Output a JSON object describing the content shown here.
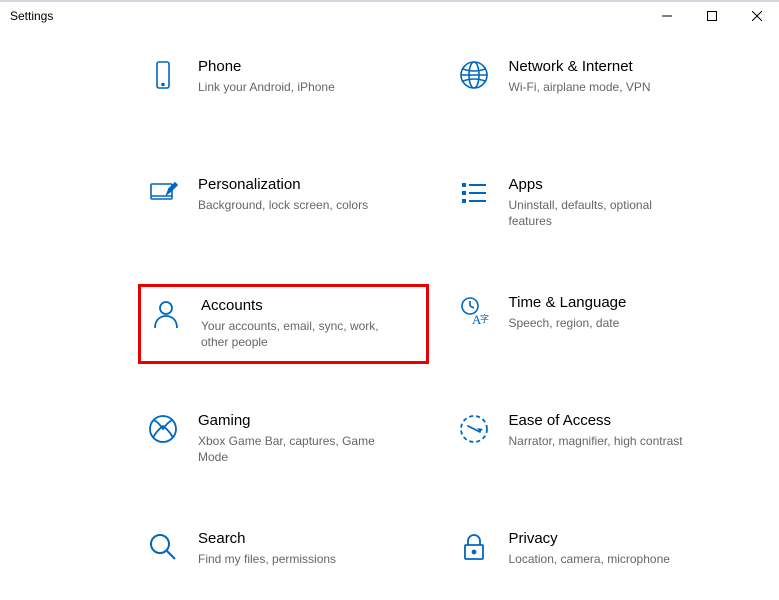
{
  "window": {
    "title": "Settings"
  },
  "iconColor": "#0067c0",
  "tiles": [
    {
      "title": "Phone",
      "subtitle": "Link your Android, iPhone"
    },
    {
      "title": "Network & Internet",
      "subtitle": "Wi-Fi, airplane mode, VPN"
    },
    {
      "title": "Personalization",
      "subtitle": "Background, lock screen, colors"
    },
    {
      "title": "Apps",
      "subtitle": "Uninstall, defaults, optional features"
    },
    {
      "title": "Accounts",
      "subtitle": "Your accounts, email, sync, work, other people"
    },
    {
      "title": "Time & Language",
      "subtitle": "Speech, region, date"
    },
    {
      "title": "Gaming",
      "subtitle": "Xbox Game Bar, captures, Game Mode"
    },
    {
      "title": "Ease of Access",
      "subtitle": "Narrator, magnifier, high contrast"
    },
    {
      "title": "Search",
      "subtitle": "Find my files, permissions"
    },
    {
      "title": "Privacy",
      "subtitle": "Location, camera, microphone"
    }
  ],
  "highlightedIndex": 4
}
